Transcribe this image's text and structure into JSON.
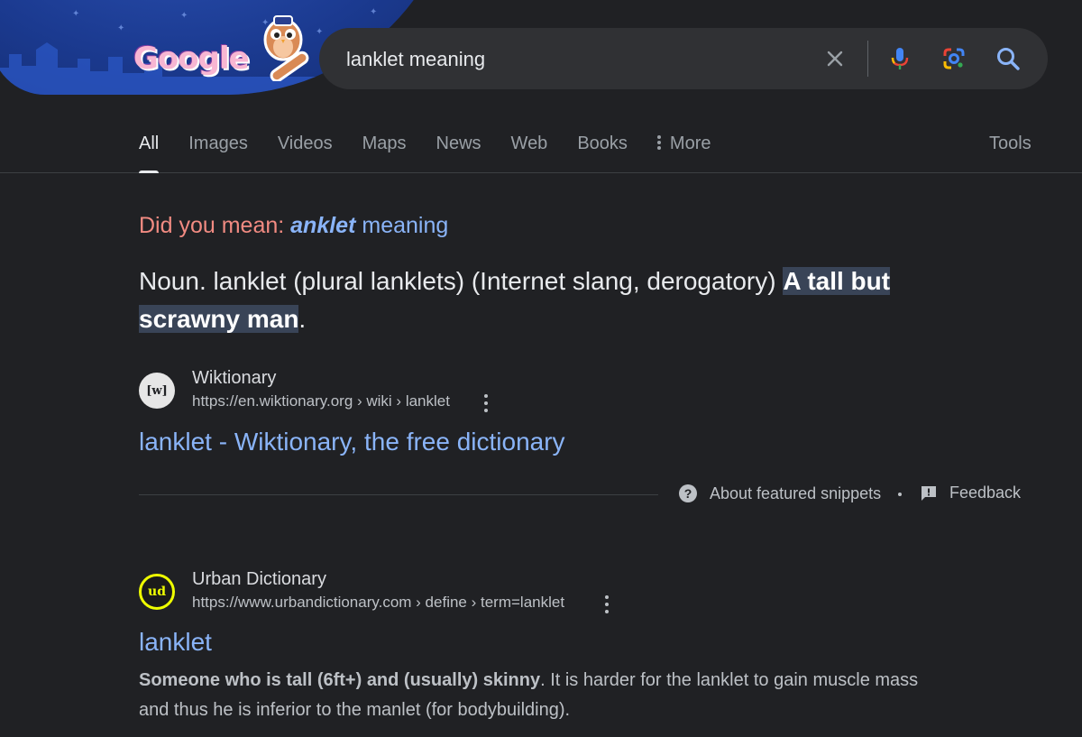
{
  "search": {
    "query": "lanklet meaning",
    "logo_text": "Google"
  },
  "tabs": [
    {
      "label": "All",
      "active": true
    },
    {
      "label": "Images",
      "active": false
    },
    {
      "label": "Videos",
      "active": false
    },
    {
      "label": "Maps",
      "active": false
    },
    {
      "label": "News",
      "active": false
    },
    {
      "label": "Web",
      "active": false
    },
    {
      "label": "Books",
      "active": false
    },
    {
      "label": "More",
      "active": false
    }
  ],
  "tools_label": "Tools",
  "did_you_mean": {
    "label": "Did you mean:",
    "suggestion_bold": "anklet",
    "suggestion_rest": "meaning"
  },
  "featured_snippet": {
    "text_plain": "Noun. lanklet (plural lanklets) (Internet slang, derogatory) ",
    "text_highlight": "A tall but scrawny man",
    "text_end": ".",
    "source_name": "Wiktionary",
    "source_url": "https://en.wiktionary.org › wiki › lanklet",
    "favicon_text": "[w]",
    "title": "lanklet - Wiktionary, the free dictionary"
  },
  "snippet_footer": {
    "about_label": "About featured snippets",
    "separator": "•",
    "feedback_label": "Feedback"
  },
  "result2": {
    "source_name": "Urban Dictionary",
    "source_url": "https://www.urbandictionary.com › define › term=lanklet",
    "favicon_text": "ud",
    "title": "lanklet",
    "desc_bold": "Someone who is tall (6ft+) and (usually) skinny",
    "desc_rest": ". It is harder for the lanklet to gain muscle mass and thus he is inferior to the manlet (for bodybuilding)."
  },
  "colors": {
    "background": "#202124",
    "link": "#8ab4f8",
    "did_you_mean_label": "#f28b82",
    "highlight": "#394457",
    "searchbox": "#303134"
  },
  "icons": {
    "clear": "close-icon",
    "voice": "microphone-icon",
    "lens": "google-lens-icon",
    "search": "search-icon",
    "about": "help-circle-icon",
    "feedback": "feedback-icon",
    "menu": "more-vert-icon"
  }
}
